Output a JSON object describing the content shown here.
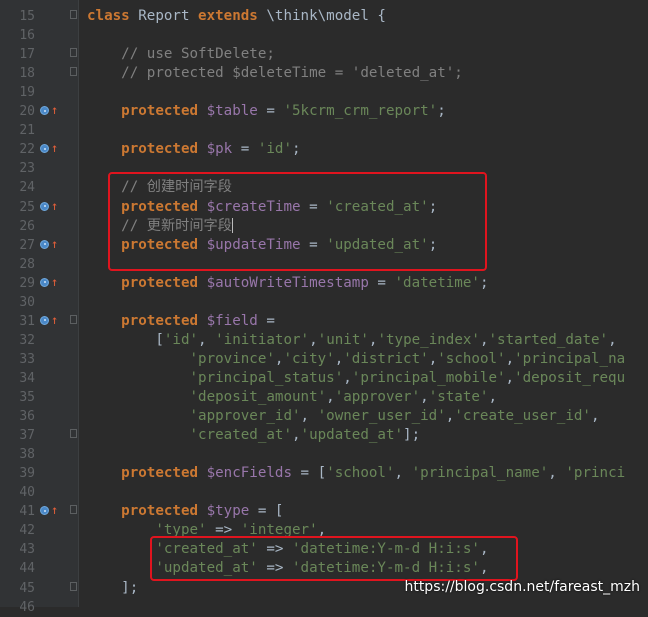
{
  "editor": {
    "lines": [
      {
        "num": "15",
        "marker": false,
        "fold": true,
        "segments": [
          [
            "kw",
            "class "
          ],
          [
            "plain",
            "Report "
          ],
          [
            "kw",
            "extends "
          ],
          [
            "plain",
            "\\think\\model {"
          ]
        ]
      },
      {
        "num": "16",
        "marker": false,
        "fold": false,
        "segments": []
      },
      {
        "num": "17",
        "marker": false,
        "fold": true,
        "segments": [
          [
            "plain",
            "    "
          ],
          [
            "cmt",
            "// use SoftDelete;"
          ]
        ]
      },
      {
        "num": "18",
        "marker": false,
        "fold": true,
        "segments": [
          [
            "plain",
            "    "
          ],
          [
            "cmt",
            "// protected $deleteTime = 'deleted_at';"
          ]
        ]
      },
      {
        "num": "19",
        "marker": false,
        "fold": false,
        "segments": []
      },
      {
        "num": "20",
        "marker": true,
        "fold": false,
        "segments": [
          [
            "plain",
            "    "
          ],
          [
            "kw",
            "protected "
          ],
          [
            "var",
            "$table"
          ],
          [
            "plain",
            " = "
          ],
          [
            "str",
            "'5kcrm_crm_report'"
          ],
          [
            "plain",
            ";"
          ]
        ]
      },
      {
        "num": "21",
        "marker": false,
        "fold": false,
        "segments": []
      },
      {
        "num": "22",
        "marker": true,
        "fold": false,
        "segments": [
          [
            "plain",
            "    "
          ],
          [
            "kw",
            "protected "
          ],
          [
            "var",
            "$pk"
          ],
          [
            "plain",
            " = "
          ],
          [
            "str",
            "'id'"
          ],
          [
            "plain",
            ";"
          ]
        ]
      },
      {
        "num": "23",
        "marker": false,
        "fold": false,
        "segments": []
      },
      {
        "num": "24",
        "marker": false,
        "fold": false,
        "segments": [
          [
            "plain",
            "    "
          ],
          [
            "cmt",
            "// "
          ],
          [
            "cmt-cjk",
            "创建时间字段"
          ]
        ]
      },
      {
        "num": "25",
        "marker": true,
        "fold": false,
        "segments": [
          [
            "plain",
            "    "
          ],
          [
            "kw",
            "protected "
          ],
          [
            "var",
            "$createTime"
          ],
          [
            "plain",
            " = "
          ],
          [
            "str",
            "'created_at'"
          ],
          [
            "plain",
            ";"
          ]
        ]
      },
      {
        "num": "26",
        "marker": false,
        "fold": false,
        "segments": [
          [
            "plain",
            "    "
          ],
          [
            "cmt",
            "// "
          ],
          [
            "cmt-cjk",
            "更新时间字段"
          ],
          [
            "caret",
            ""
          ]
        ]
      },
      {
        "num": "27",
        "marker": true,
        "fold": false,
        "segments": [
          [
            "plain",
            "    "
          ],
          [
            "kw",
            "protected "
          ],
          [
            "var",
            "$updateTime"
          ],
          [
            "plain",
            " = "
          ],
          [
            "str",
            "'updated_at'"
          ],
          [
            "plain",
            ";"
          ]
        ]
      },
      {
        "num": "28",
        "marker": false,
        "fold": false,
        "segments": []
      },
      {
        "num": "29",
        "marker": true,
        "fold": false,
        "segments": [
          [
            "plain",
            "    "
          ],
          [
            "kw",
            "protected "
          ],
          [
            "var",
            "$autoWriteTimestamp"
          ],
          [
            "plain",
            " = "
          ],
          [
            "str",
            "'datetime'"
          ],
          [
            "plain",
            ";"
          ]
        ]
      },
      {
        "num": "30",
        "marker": false,
        "fold": false,
        "segments": []
      },
      {
        "num": "31",
        "marker": true,
        "fold": true,
        "segments": [
          [
            "plain",
            "    "
          ],
          [
            "kw",
            "protected "
          ],
          [
            "var",
            "$field"
          ],
          [
            "plain",
            " ="
          ]
        ]
      },
      {
        "num": "32",
        "marker": false,
        "fold": false,
        "segments": [
          [
            "plain",
            "        ["
          ],
          [
            "str",
            "'id'"
          ],
          [
            "plain",
            ", "
          ],
          [
            "str",
            "'initiator'"
          ],
          [
            "plain",
            ","
          ],
          [
            "str",
            "'unit'"
          ],
          [
            "plain",
            ","
          ],
          [
            "str",
            "'type_index'"
          ],
          [
            "plain",
            ","
          ],
          [
            "str",
            "'started_date'"
          ],
          [
            "plain",
            ","
          ]
        ]
      },
      {
        "num": "33",
        "marker": false,
        "fold": false,
        "segments": [
          [
            "plain",
            "            "
          ],
          [
            "str",
            "'province'"
          ],
          [
            "plain",
            ","
          ],
          [
            "str",
            "'city'"
          ],
          [
            "plain",
            ","
          ],
          [
            "str",
            "'district'"
          ],
          [
            "plain",
            ","
          ],
          [
            "str",
            "'school'"
          ],
          [
            "plain",
            ","
          ],
          [
            "str",
            "'principal_na"
          ]
        ]
      },
      {
        "num": "34",
        "marker": false,
        "fold": false,
        "segments": [
          [
            "plain",
            "            "
          ],
          [
            "str",
            "'principal_status'"
          ],
          [
            "plain",
            ","
          ],
          [
            "str",
            "'principal_mobile'"
          ],
          [
            "plain",
            ","
          ],
          [
            "str",
            "'deposit_requ"
          ]
        ]
      },
      {
        "num": "35",
        "marker": false,
        "fold": false,
        "segments": [
          [
            "plain",
            "            "
          ],
          [
            "str",
            "'deposit_amount'"
          ],
          [
            "plain",
            ","
          ],
          [
            "str",
            "'approver'"
          ],
          [
            "plain",
            ","
          ],
          [
            "str",
            "'state'"
          ],
          [
            "plain",
            ","
          ]
        ]
      },
      {
        "num": "36",
        "marker": false,
        "fold": false,
        "segments": [
          [
            "plain",
            "            "
          ],
          [
            "str",
            "'approver_id'"
          ],
          [
            "plain",
            ", "
          ],
          [
            "str",
            "'owner_user_id'"
          ],
          [
            "plain",
            ","
          ],
          [
            "str",
            "'create_user_id'"
          ],
          [
            "plain",
            ","
          ]
        ]
      },
      {
        "num": "37",
        "marker": false,
        "fold": true,
        "segments": [
          [
            "plain",
            "            "
          ],
          [
            "str",
            "'created_at'"
          ],
          [
            "plain",
            ","
          ],
          [
            "str",
            "'updated_at'"
          ],
          [
            "plain",
            "];"
          ]
        ]
      },
      {
        "num": "38",
        "marker": false,
        "fold": false,
        "segments": []
      },
      {
        "num": "39",
        "marker": false,
        "fold": false,
        "segments": [
          [
            "plain",
            "    "
          ],
          [
            "kw",
            "protected "
          ],
          [
            "var",
            "$encFields"
          ],
          [
            "plain",
            " = ["
          ],
          [
            "str",
            "'school'"
          ],
          [
            "plain",
            ", "
          ],
          [
            "str",
            "'principal_name'"
          ],
          [
            "plain",
            ", "
          ],
          [
            "str",
            "'princi"
          ]
        ]
      },
      {
        "num": "40",
        "marker": false,
        "fold": false,
        "segments": []
      },
      {
        "num": "41",
        "marker": true,
        "fold": true,
        "segments": [
          [
            "plain",
            "    "
          ],
          [
            "kw",
            "protected "
          ],
          [
            "var",
            "$type"
          ],
          [
            "plain",
            " = ["
          ]
        ]
      },
      {
        "num": "42",
        "marker": false,
        "fold": false,
        "segments": [
          [
            "plain",
            "        "
          ],
          [
            "str",
            "'type'"
          ],
          [
            "plain",
            " => "
          ],
          [
            "str",
            "'integer'"
          ],
          [
            "plain",
            ","
          ]
        ]
      },
      {
        "num": "43",
        "marker": false,
        "fold": false,
        "segments": [
          [
            "plain",
            "        "
          ],
          [
            "str",
            "'created_at'"
          ],
          [
            "plain",
            " => "
          ],
          [
            "str",
            "'datetime:Y-m-d H:i:s'"
          ],
          [
            "plain",
            ","
          ]
        ]
      },
      {
        "num": "44",
        "marker": false,
        "fold": false,
        "segments": [
          [
            "plain",
            "        "
          ],
          [
            "str",
            "'updated_at'"
          ],
          [
            "plain",
            " => "
          ],
          [
            "str",
            "'datetime:Y-m-d H:i:s'"
          ],
          [
            "plain",
            ","
          ]
        ]
      },
      {
        "num": "45",
        "marker": false,
        "fold": true,
        "segments": [
          [
            "plain",
            "    ];"
          ]
        ]
      },
      {
        "num": "46",
        "marker": false,
        "fold": false,
        "segments": []
      }
    ]
  },
  "watermark": "https://blog.csdn.net/fareast_mzh",
  "colors": {
    "background": "#2b2b2b",
    "keyword": "#cc7832",
    "string": "#6a8759",
    "variable": "#9876aa",
    "comment": "#808080",
    "highlight": "#e0141e"
  }
}
